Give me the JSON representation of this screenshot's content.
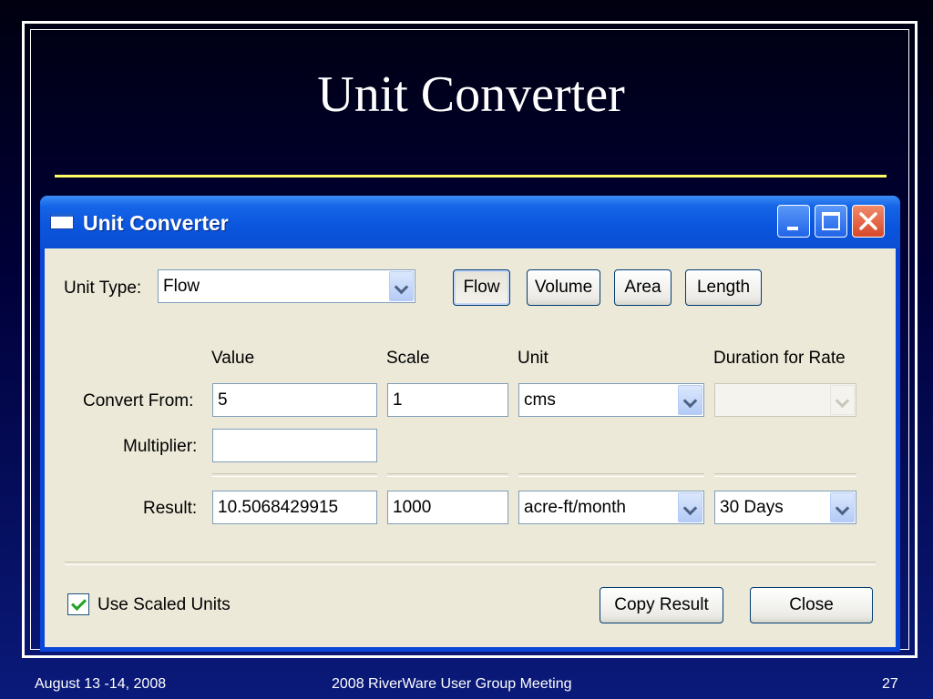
{
  "slide": {
    "title": "Unit Converter",
    "footer_left": "August 13 -14, 2008",
    "footer_center": "2008 RiverWare User Group Meeting",
    "footer_right": "27"
  },
  "window": {
    "title": "Unit Converter",
    "unit_type_label": "Unit Type:",
    "unit_type_value": "Flow",
    "type_buttons": [
      "Flow",
      "Volume",
      "Area",
      "Length"
    ],
    "active_type": "Flow",
    "columns": {
      "value": "Value",
      "scale": "Scale",
      "unit": "Unit",
      "duration": "Duration for Rate"
    },
    "convert_from": {
      "label": "Convert From:",
      "value": "5",
      "scale": "1",
      "unit": "cms",
      "duration": ""
    },
    "multiplier": {
      "label": "Multiplier:",
      "value": ""
    },
    "result": {
      "label": "Result:",
      "value": "10.5068429915",
      "scale": "1000",
      "unit": "acre-ft/month",
      "duration": "30 Days"
    },
    "use_scaled_units_label": "Use Scaled Units",
    "use_scaled_units_checked": true,
    "copy_result_label": "Copy Result",
    "close_label": "Close"
  },
  "icons": {
    "window_icon": "window-icon",
    "minimize": "minimize-icon",
    "maximize": "maximize-icon",
    "close": "close-icon"
  }
}
